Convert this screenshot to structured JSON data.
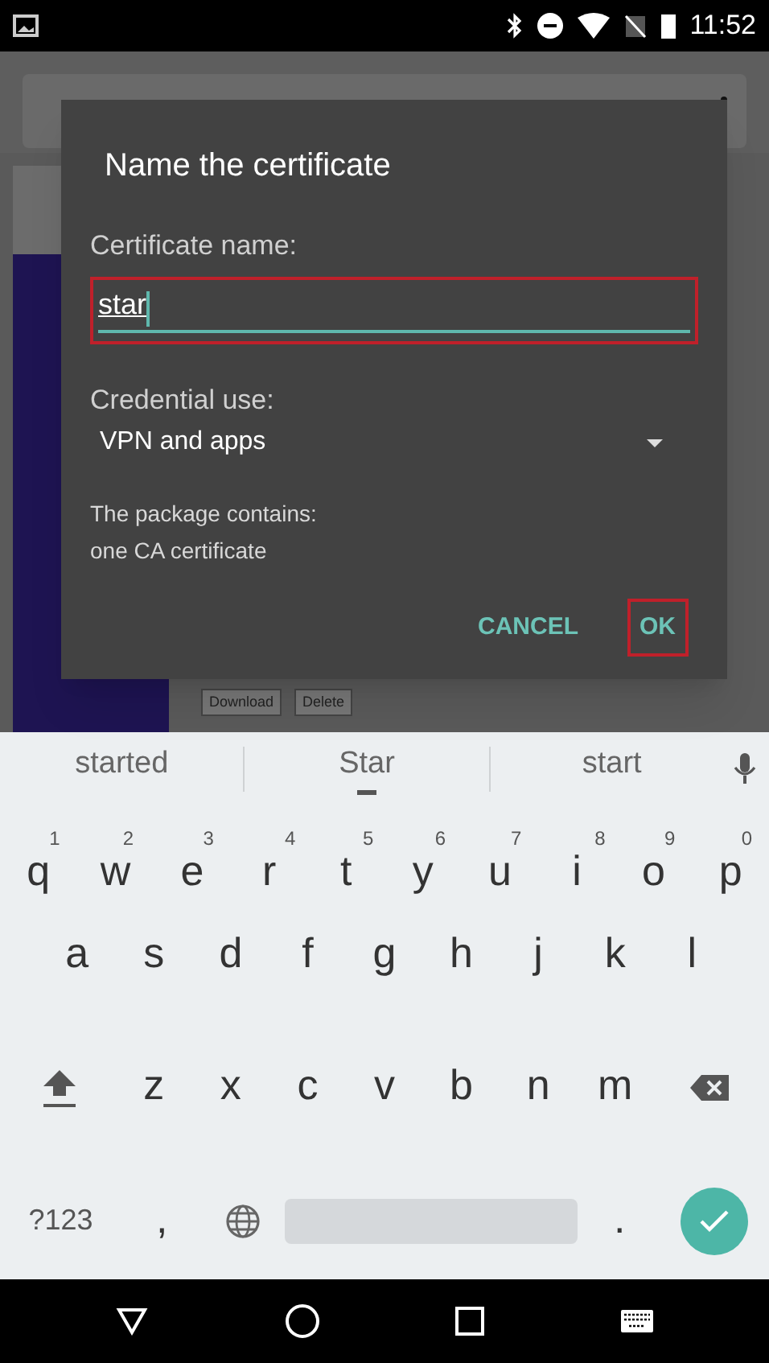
{
  "status_bar": {
    "time": "11:52"
  },
  "page": {
    "buttons": [
      "Download",
      "Delete"
    ]
  },
  "dialog": {
    "title": "Name the certificate",
    "name_label": "Certificate name:",
    "name_value": "star",
    "use_label": "Credential use:",
    "use_value": "VPN and apps",
    "info": [
      "The package contains:",
      "one CA certificate"
    ],
    "buttons": [
      {
        "label": "CANCEL",
        "highlighted": false
      },
      {
        "label": "OK",
        "highlighted": true
      }
    ],
    "field_highlighted": true
  },
  "suggestions": [
    {
      "text": "started",
      "selected": false
    },
    {
      "text": "Star",
      "selected": true
    },
    {
      "text": "start",
      "selected": false
    }
  ],
  "keyboard": {
    "row_1": [
      {
        "kind": "letter",
        "label": "q",
        "hint": "1"
      },
      {
        "kind": "letter",
        "label": "w",
        "hint": "2"
      },
      {
        "kind": "letter",
        "label": "e",
        "hint": "3"
      },
      {
        "kind": "letter",
        "label": "r",
        "hint": "4"
      },
      {
        "kind": "letter",
        "label": "t",
        "hint": "5"
      },
      {
        "kind": "letter",
        "label": "y",
        "hint": "6"
      },
      {
        "kind": "letter",
        "label": "u",
        "hint": "7"
      },
      {
        "kind": "letter",
        "label": "i",
        "hint": "8"
      },
      {
        "kind": "letter",
        "label": "o",
        "hint": "9"
      },
      {
        "kind": "letter",
        "label": "p",
        "hint": "0"
      }
    ],
    "row_2": [
      {
        "kind": "letter",
        "label": "a"
      },
      {
        "kind": "letter",
        "label": "s"
      },
      {
        "kind": "letter",
        "label": "d"
      },
      {
        "kind": "letter",
        "label": "f"
      },
      {
        "kind": "letter",
        "label": "g"
      },
      {
        "kind": "letter",
        "label": "h"
      },
      {
        "kind": "letter",
        "label": "j"
      },
      {
        "kind": "letter",
        "label": "k"
      },
      {
        "kind": "letter",
        "label": "l"
      }
    ],
    "row_3": [
      {
        "kind": "shift"
      },
      {
        "kind": "letter",
        "label": "z"
      },
      {
        "kind": "letter",
        "label": "x"
      },
      {
        "kind": "letter",
        "label": "c"
      },
      {
        "kind": "letter",
        "label": "v"
      },
      {
        "kind": "letter",
        "label": "b"
      },
      {
        "kind": "letter",
        "label": "n"
      },
      {
        "kind": "letter",
        "label": "m"
      },
      {
        "kind": "backspace"
      }
    ],
    "bottom_row": [
      {
        "kind": "symbols",
        "label": "?123"
      },
      {
        "kind": "letter",
        "label": ","
      },
      {
        "kind": "globe"
      },
      {
        "kind": "space"
      },
      {
        "kind": "letter",
        "label": "."
      },
      {
        "kind": "enter"
      }
    ]
  }
}
